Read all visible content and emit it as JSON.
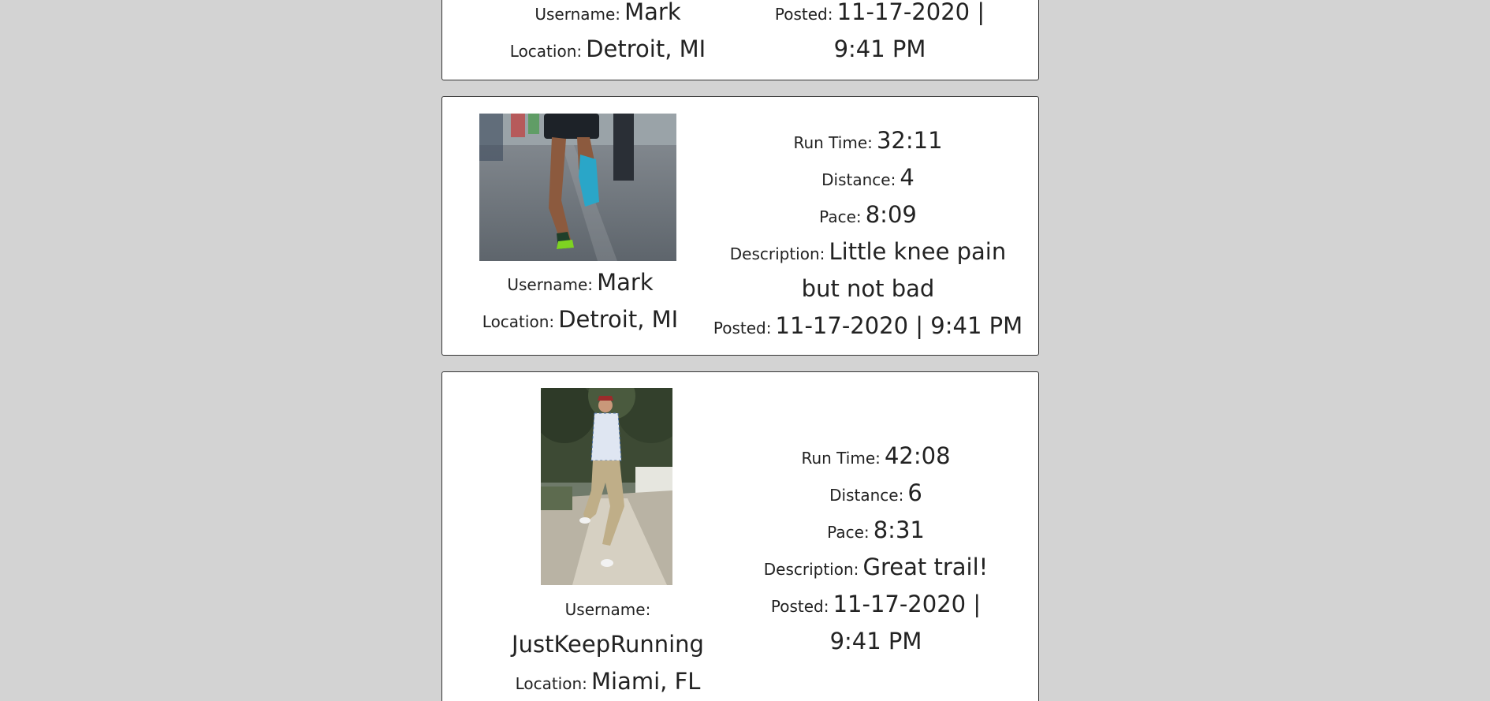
{
  "labels": {
    "username": "Username:",
    "location": "Location:",
    "run_time": "Run Time:",
    "distance": "Distance:",
    "pace": "Pace:",
    "description": "Description:",
    "posted": "Posted:"
  },
  "posts": [
    {
      "username": "Mark",
      "location": "Detroit, MI",
      "posted": "11-17-2020 | 9:41 PM"
    },
    {
      "username": "Mark",
      "location": "Detroit, MI",
      "run_time": "32:11",
      "distance": "4",
      "pace": "8:09",
      "description": "Little knee pain but not bad",
      "posted": "11-17-2020 | 9:41 PM"
    },
    {
      "username": "JustKeepRunning",
      "location": "Miami, FL",
      "run_time": "42:08",
      "distance": "6",
      "pace": "8:31",
      "description": "Great trail!",
      "posted": "11-17-2020 | 9:41 PM"
    }
  ]
}
